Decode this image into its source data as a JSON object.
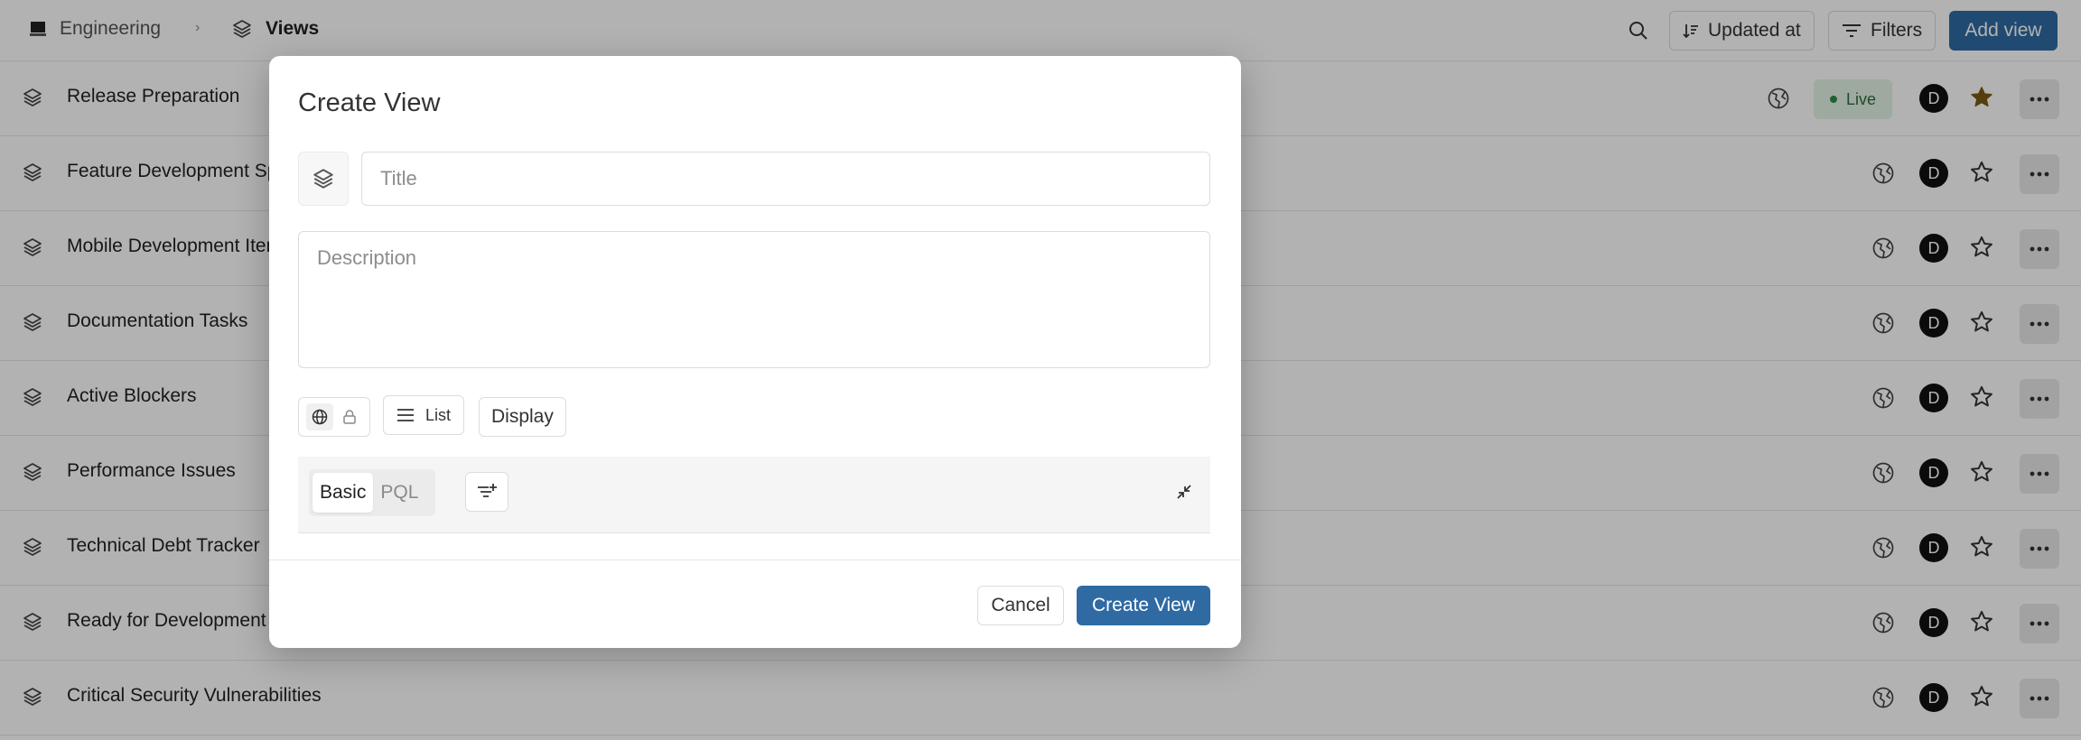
{
  "header": {
    "breadcrumb": {
      "workspace": "Engineering",
      "page": "Views",
      "separator": "›"
    },
    "sort_label": "Updated at",
    "filters_label": "Filters",
    "add_view_label": "Add view"
  },
  "rows": [
    {
      "title": "Release Preparation",
      "live_label": "Live",
      "avatar": "D",
      "starred": true
    },
    {
      "title": "Feature Development Sprint",
      "avatar": "D",
      "starred": false
    },
    {
      "title": "Mobile Development Items",
      "avatar": "D",
      "starred": false
    },
    {
      "title": "Documentation Tasks",
      "avatar": "D",
      "starred": false
    },
    {
      "title": "Active Blockers",
      "avatar": "D",
      "starred": false
    },
    {
      "title": "Performance Issues",
      "avatar": "D",
      "starred": false
    },
    {
      "title": "Technical Debt Tracker",
      "avatar": "D",
      "starred": false
    },
    {
      "title": "Ready for Development",
      "avatar": "D",
      "starred": false
    },
    {
      "title": "Critical Security Vulnerabilities",
      "avatar": "D",
      "starred": false
    }
  ],
  "modal": {
    "title": "Create View",
    "title_placeholder": "Title",
    "description_placeholder": "Description",
    "layout_label": "List",
    "display_label": "Display",
    "modes": [
      "Basic",
      "PQL"
    ],
    "active_mode": "Basic",
    "cancel_label": "Cancel",
    "submit_label": "Create View"
  },
  "colors": {
    "accent": "#2f6aa3",
    "star": "#7a5a12",
    "live_bg": "#e3f3e6",
    "live_text": "#2f6a3b"
  }
}
